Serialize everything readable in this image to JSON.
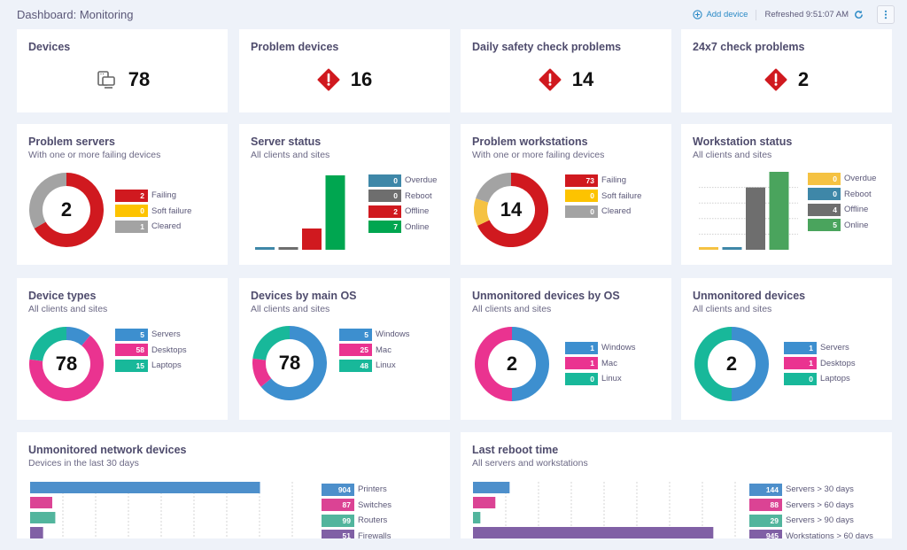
{
  "header": {
    "title": "Dashboard: Monitoring",
    "add_device_label": "Add device",
    "refreshed_label": "Refreshed 9:51:07 AM"
  },
  "colors": {
    "red": "#d0191f",
    "yellow": "#f5c242",
    "gray": "#a3a3a3",
    "dark_gray": "#6e6e6e",
    "blue": "#3d8fcf",
    "steel_blue": "#3e87a8",
    "green": "#00a650",
    "light_green": "#4aa45d",
    "pink": "#ea3390",
    "teal": "#18b89a",
    "purple": "#8060a5",
    "link": "#2b8ac6"
  },
  "kpis": [
    {
      "title": "Devices",
      "value": "78",
      "icon": "devices-icon"
    },
    {
      "title": "Problem devices",
      "value": "16",
      "icon": "alert-diamond-icon"
    },
    {
      "title": "Daily safety check problems",
      "value": "14",
      "icon": "alert-diamond-icon"
    },
    {
      "title": "24x7 check problems",
      "value": "2",
      "icon": "alert-diamond-icon"
    }
  ],
  "widgets": {
    "problem_servers": {
      "title": "Problem servers",
      "subtitle": "With one or more failing devices",
      "center": "2",
      "legend": [
        {
          "value": "2",
          "label": "Failing",
          "color": "#d0191f"
        },
        {
          "value": "0",
          "label": "Soft failure",
          "color": "#fdc300"
        },
        {
          "value": "1",
          "label": "Cleared",
          "color": "#a3a3a3"
        }
      ]
    },
    "server_status": {
      "title": "Server status",
      "subtitle": "All clients and sites",
      "legend": [
        {
          "value": "0",
          "label": "Overdue",
          "color": "#3e87a8"
        },
        {
          "value": "0",
          "label": "Reboot",
          "color": "#6e6e6e"
        },
        {
          "value": "2",
          "label": "Offline",
          "color": "#d0191f"
        },
        {
          "value": "7",
          "label": "Online",
          "color": "#00a650"
        }
      ]
    },
    "problem_workstations": {
      "title": "Problem workstations",
      "subtitle": "With one or more failing devices",
      "center": "14",
      "legend": [
        {
          "value": "73",
          "label": "Failing",
          "color": "#d0191f"
        },
        {
          "value": "0",
          "label": "Soft failure",
          "color": "#fdc300"
        },
        {
          "value": "0",
          "label": "Cleared",
          "color": "#a3a3a3"
        }
      ]
    },
    "workstation_status": {
      "title": "Workstation status",
      "subtitle": "All clients and sites",
      "legend": [
        {
          "value": "0",
          "label": "Overdue",
          "color": "#f5c242"
        },
        {
          "value": "0",
          "label": "Reboot",
          "color": "#3e87a8"
        },
        {
          "value": "4",
          "label": "Offline",
          "color": "#6e6e6e"
        },
        {
          "value": "5",
          "label": "Online",
          "color": "#4aa45d"
        }
      ]
    },
    "device_types": {
      "title": "Device types",
      "subtitle": "All clients and sites",
      "center": "78",
      "legend": [
        {
          "value": "5",
          "label": "Servers",
          "color": "#3d8fcf"
        },
        {
          "value": "58",
          "label": "Desktops",
          "color": "#ea3390"
        },
        {
          "value": "15",
          "label": "Laptops",
          "color": "#18b89a"
        }
      ]
    },
    "devices_by_os": {
      "title": "Devices by main OS",
      "subtitle": "All clients and sites",
      "center": "78",
      "legend": [
        {
          "value": "5",
          "label": "Windows",
          "color": "#3d8fcf"
        },
        {
          "value": "25",
          "label": "Mac",
          "color": "#ea3390"
        },
        {
          "value": "48",
          "label": "Linux",
          "color": "#18b89a"
        }
      ]
    },
    "unmonitored_by_os": {
      "title": "Unmonitored devices by OS",
      "subtitle": "All clients and sites",
      "center": "2",
      "legend": [
        {
          "value": "1",
          "label": "Windows",
          "color": "#3d8fcf"
        },
        {
          "value": "1",
          "label": "Mac",
          "color": "#ea3390"
        },
        {
          "value": "0",
          "label": "Linux",
          "color": "#18b89a"
        }
      ]
    },
    "unmonitored_devices": {
      "title": "Unmonitored devices",
      "subtitle": "All clients and sites",
      "center": "2",
      "legend": [
        {
          "value": "1",
          "label": "Servers",
          "color": "#3d8fcf"
        },
        {
          "value": "1",
          "label": "Desktops",
          "color": "#ea3390"
        },
        {
          "value": "0",
          "label": "Laptops",
          "color": "#18b89a"
        }
      ]
    },
    "unmonitored_network": {
      "title": "Unmonitored network devices",
      "subtitle": "Devices in the last 30 days",
      "legend": [
        {
          "value": "904",
          "label": "Printers",
          "color": "#4d8fcb"
        },
        {
          "value": "87",
          "label": "Switches",
          "color": "#db4394"
        },
        {
          "value": "99",
          "label": "Routers",
          "color": "#52b59d"
        },
        {
          "value": "51",
          "label": "Firewalls",
          "color": "#8060a5"
        }
      ]
    },
    "last_reboot": {
      "title": "Last reboot time",
      "subtitle": "All servers and workstations",
      "legend": [
        {
          "value": "144",
          "label": "Servers > 30 days",
          "color": "#4d8fcb"
        },
        {
          "value": "88",
          "label": "Servers > 60 days",
          "color": "#db4394"
        },
        {
          "value": "29",
          "label": "Servers > 90 days",
          "color": "#52b59d"
        },
        {
          "value": "945",
          "label": "Workstations > 60 days",
          "color": "#8060a5"
        }
      ]
    }
  },
  "chart_data": [
    {
      "id": "problem_servers",
      "type": "pie",
      "title": "Problem servers",
      "categories": [
        "Failing",
        "Soft failure",
        "Cleared"
      ],
      "values": [
        2,
        0,
        1
      ],
      "colors": [
        "#d0191f",
        "#fdc300",
        "#a3a3a3"
      ]
    },
    {
      "id": "server_status",
      "type": "bar",
      "title": "Server status",
      "categories": [
        "Overdue",
        "Reboot",
        "Offline",
        "Online"
      ],
      "values": [
        0,
        0,
        2,
        7
      ],
      "colors": [
        "#3e87a8",
        "#6e6e6e",
        "#d0191f",
        "#00a650"
      ],
      "grid": false
    },
    {
      "id": "problem_workstations",
      "type": "pie",
      "title": "Problem workstations",
      "categories": [
        "Failing",
        "Soft failure",
        "Cleared"
      ],
      "values": [
        73,
        0,
        0
      ],
      "display_fractions": [
        0.68,
        0.12,
        0.2
      ],
      "colors": [
        "#d0191f",
        "#f5c242",
        "#a3a3a3"
      ]
    },
    {
      "id": "workstation_status",
      "type": "bar",
      "title": "Workstation status",
      "categories": [
        "Overdue",
        "Reboot",
        "Offline",
        "Online"
      ],
      "values": [
        0,
        0,
        4,
        5
      ],
      "colors": [
        "#f5c242",
        "#3e87a8",
        "#6e6e6e",
        "#4aa45d"
      ],
      "grid": true
    },
    {
      "id": "device_types",
      "type": "pie",
      "title": "Device types",
      "categories": [
        "Servers",
        "Desktops",
        "Laptops"
      ],
      "values": [
        5,
        58,
        15
      ],
      "display_fractions": [
        0.11,
        0.66,
        0.23
      ],
      "colors": [
        "#3d8fcf",
        "#ea3390",
        "#18b89a"
      ]
    },
    {
      "id": "devices_by_os",
      "type": "pie",
      "title": "Devices by main OS",
      "categories": [
        "Windows",
        "Mac",
        "Linux"
      ],
      "values": [
        5,
        25,
        48
      ],
      "display_fractions": [
        0.64,
        0.13,
        0.23
      ],
      "colors": [
        "#3d8fcf",
        "#ea3390",
        "#18b89a"
      ]
    },
    {
      "id": "unmonitored_by_os",
      "type": "pie",
      "title": "Unmonitored devices by OS",
      "categories": [
        "Windows",
        "Mac",
        "Linux"
      ],
      "values": [
        1,
        1,
        0
      ],
      "colors": [
        "#3d8fcf",
        "#ea3390",
        "#18b89a"
      ]
    },
    {
      "id": "unmonitored_devices",
      "type": "pie",
      "title": "Unmonitored devices",
      "categories": [
        "Servers",
        "Desktops",
        "Laptops"
      ],
      "values": [
        1,
        1,
        0
      ],
      "display_fractions": [
        0.5,
        0,
        0.5
      ],
      "colors": [
        "#3d8fcf",
        "#ea3390",
        "#18b89a"
      ]
    },
    {
      "id": "unmonitored_network",
      "type": "bar",
      "orientation": "horizontal",
      "title": "Unmonitored network devices",
      "categories": [
        "Printers",
        "Switches",
        "Routers",
        "Firewalls"
      ],
      "values": [
        904,
        87,
        99,
        51
      ],
      "colors": [
        "#4d8fcb",
        "#db4394",
        "#52b59d",
        "#8060a5"
      ],
      "xlim": [
        0,
        1000
      ],
      "grid": true
    },
    {
      "id": "last_reboot",
      "type": "bar",
      "orientation": "horizontal",
      "title": "Last reboot time",
      "categories": [
        "Servers > 30 days",
        "Servers > 60 days",
        "Servers > 90 days",
        "Workstations > 60 days"
      ],
      "values": [
        144,
        88,
        29,
        945
      ],
      "colors": [
        "#4d8fcb",
        "#db4394",
        "#52b59d",
        "#8060a5"
      ],
      "xlim": [
        0,
        1000
      ],
      "grid": true
    }
  ]
}
